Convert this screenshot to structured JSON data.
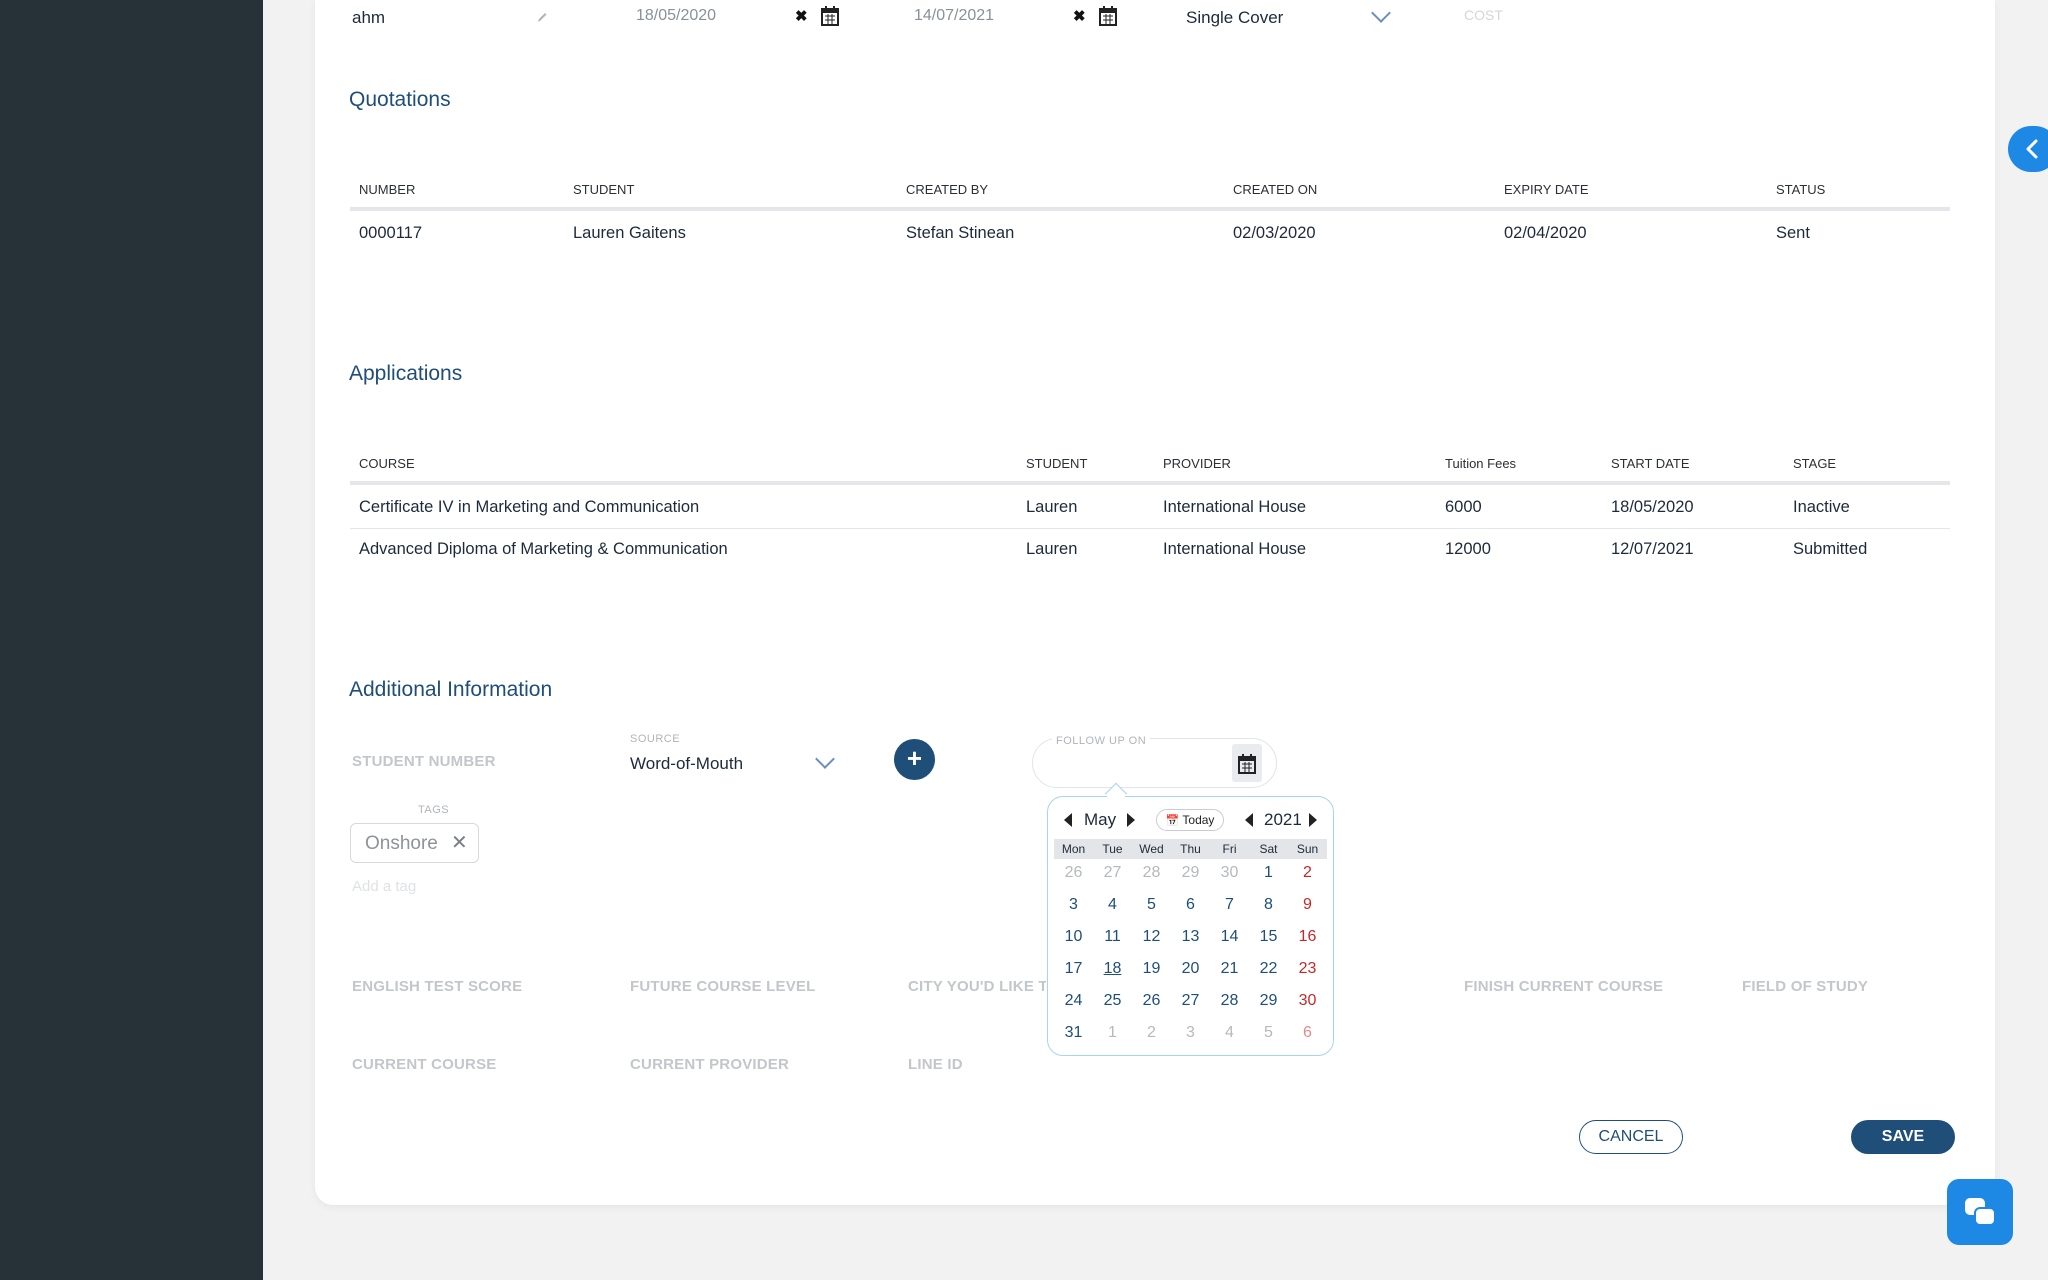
{
  "top_row": {
    "name_value": "ahm",
    "start_date": "18/05/2020",
    "end_date": "14/07/2021",
    "cover": "Single Cover",
    "cost_placeholder": "COST"
  },
  "quotations": {
    "title": "Quotations",
    "headers": [
      "NUMBER",
      "STUDENT",
      "CREATED BY",
      "CREATED ON",
      "EXPIRY DATE",
      "STATUS"
    ],
    "rows": [
      [
        "0000117",
        "Lauren Gaitens",
        "Stefan Stinean",
        "02/03/2020",
        "02/04/2020",
        "Sent"
      ]
    ]
  },
  "applications": {
    "title": "Applications",
    "headers": [
      "COURSE",
      "STUDENT",
      "PROVIDER",
      "Tuition Fees",
      "START DATE",
      "STAGE"
    ],
    "rows": [
      [
        "Certificate IV in Marketing and Communication",
        "Lauren",
        "International House",
        "6000",
        "18/05/2020",
        "Inactive"
      ],
      [
        "Advanced Diploma of Marketing & Communication",
        "Lauren",
        "International House",
        "12000",
        "12/07/2021",
        "Submitted"
      ]
    ]
  },
  "additional": {
    "title": "Additional Information",
    "student_number_label": "STUDENT NUMBER",
    "source_label": "SOURCE",
    "source_value": "Word-of-Mouth",
    "follow_up_label": "FOLLOW UP ON",
    "tags_label": "TAGS",
    "tag": "Onshore",
    "add_tag_placeholder": "Add a tag",
    "fields_row1": [
      "ENGLISH TEST SCORE",
      "FUTURE COURSE LEVEL",
      "CITY YOU'D LIKE TO S",
      "FINISH CURRENT COURSE",
      "FIELD OF STUDY"
    ],
    "fields_row2": [
      "CURRENT COURSE",
      "CURRENT PROVIDER",
      "LINE ID"
    ]
  },
  "datepicker": {
    "month": "May",
    "year": "2021",
    "today_label": "Today",
    "weekdays": [
      "Mon",
      "Tue",
      "Wed",
      "Thu",
      "Fri",
      "Sat",
      "Sun"
    ],
    "weeks": [
      [
        "26",
        "27",
        "28",
        "29",
        "30",
        "1",
        "2"
      ],
      [
        "3",
        "4",
        "5",
        "6",
        "7",
        "8",
        "9"
      ],
      [
        "10",
        "11",
        "12",
        "13",
        "14",
        "15",
        "16"
      ],
      [
        "17",
        "18",
        "19",
        "20",
        "21",
        "22",
        "23"
      ],
      [
        "24",
        "25",
        "26",
        "27",
        "28",
        "29",
        "30"
      ],
      [
        "31",
        "1",
        "2",
        "3",
        "4",
        "5",
        "6"
      ]
    ],
    "today_day": "18"
  },
  "actions": {
    "cancel": "CANCEL",
    "save": "SAVE"
  },
  "colors": {
    "primary": "#1f4e79",
    "accent": "#1e88e5",
    "sidebar": "#263238",
    "weekend": "#c62828"
  }
}
